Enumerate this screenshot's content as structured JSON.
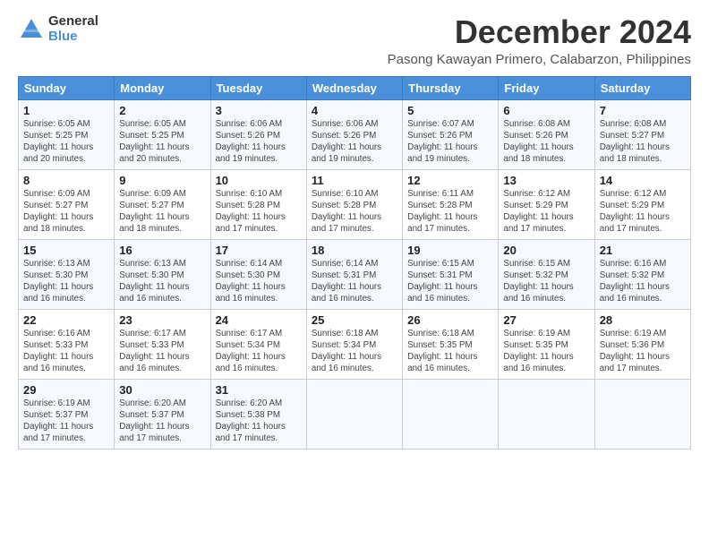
{
  "logo": {
    "line1": "General",
    "line2": "Blue"
  },
  "title": "December 2024",
  "subtitle": "Pasong Kawayan Primero, Calabarzon, Philippines",
  "weekdays": [
    "Sunday",
    "Monday",
    "Tuesday",
    "Wednesday",
    "Thursday",
    "Friday",
    "Saturday"
  ],
  "weeks": [
    [
      {
        "day": "1",
        "info": "Sunrise: 6:05 AM\nSunset: 5:25 PM\nDaylight: 11 hours\nand 20 minutes."
      },
      {
        "day": "2",
        "info": "Sunrise: 6:05 AM\nSunset: 5:25 PM\nDaylight: 11 hours\nand 20 minutes."
      },
      {
        "day": "3",
        "info": "Sunrise: 6:06 AM\nSunset: 5:26 PM\nDaylight: 11 hours\nand 19 minutes."
      },
      {
        "day": "4",
        "info": "Sunrise: 6:06 AM\nSunset: 5:26 PM\nDaylight: 11 hours\nand 19 minutes."
      },
      {
        "day": "5",
        "info": "Sunrise: 6:07 AM\nSunset: 5:26 PM\nDaylight: 11 hours\nand 19 minutes."
      },
      {
        "day": "6",
        "info": "Sunrise: 6:08 AM\nSunset: 5:26 PM\nDaylight: 11 hours\nand 18 minutes."
      },
      {
        "day": "7",
        "info": "Sunrise: 6:08 AM\nSunset: 5:27 PM\nDaylight: 11 hours\nand 18 minutes."
      }
    ],
    [
      {
        "day": "8",
        "info": "Sunrise: 6:09 AM\nSunset: 5:27 PM\nDaylight: 11 hours\nand 18 minutes."
      },
      {
        "day": "9",
        "info": "Sunrise: 6:09 AM\nSunset: 5:27 PM\nDaylight: 11 hours\nand 18 minutes."
      },
      {
        "day": "10",
        "info": "Sunrise: 6:10 AM\nSunset: 5:28 PM\nDaylight: 11 hours\nand 17 minutes."
      },
      {
        "day": "11",
        "info": "Sunrise: 6:10 AM\nSunset: 5:28 PM\nDaylight: 11 hours\nand 17 minutes."
      },
      {
        "day": "12",
        "info": "Sunrise: 6:11 AM\nSunset: 5:28 PM\nDaylight: 11 hours\nand 17 minutes."
      },
      {
        "day": "13",
        "info": "Sunrise: 6:12 AM\nSunset: 5:29 PM\nDaylight: 11 hours\nand 17 minutes."
      },
      {
        "day": "14",
        "info": "Sunrise: 6:12 AM\nSunset: 5:29 PM\nDaylight: 11 hours\nand 17 minutes."
      }
    ],
    [
      {
        "day": "15",
        "info": "Sunrise: 6:13 AM\nSunset: 5:30 PM\nDaylight: 11 hours\nand 16 minutes."
      },
      {
        "day": "16",
        "info": "Sunrise: 6:13 AM\nSunset: 5:30 PM\nDaylight: 11 hours\nand 16 minutes."
      },
      {
        "day": "17",
        "info": "Sunrise: 6:14 AM\nSunset: 5:30 PM\nDaylight: 11 hours\nand 16 minutes."
      },
      {
        "day": "18",
        "info": "Sunrise: 6:14 AM\nSunset: 5:31 PM\nDaylight: 11 hours\nand 16 minutes."
      },
      {
        "day": "19",
        "info": "Sunrise: 6:15 AM\nSunset: 5:31 PM\nDaylight: 11 hours\nand 16 minutes."
      },
      {
        "day": "20",
        "info": "Sunrise: 6:15 AM\nSunset: 5:32 PM\nDaylight: 11 hours\nand 16 minutes."
      },
      {
        "day": "21",
        "info": "Sunrise: 6:16 AM\nSunset: 5:32 PM\nDaylight: 11 hours\nand 16 minutes."
      }
    ],
    [
      {
        "day": "22",
        "info": "Sunrise: 6:16 AM\nSunset: 5:33 PM\nDaylight: 11 hours\nand 16 minutes."
      },
      {
        "day": "23",
        "info": "Sunrise: 6:17 AM\nSunset: 5:33 PM\nDaylight: 11 hours\nand 16 minutes."
      },
      {
        "day": "24",
        "info": "Sunrise: 6:17 AM\nSunset: 5:34 PM\nDaylight: 11 hours\nand 16 minutes."
      },
      {
        "day": "25",
        "info": "Sunrise: 6:18 AM\nSunset: 5:34 PM\nDaylight: 11 hours\nand 16 minutes."
      },
      {
        "day": "26",
        "info": "Sunrise: 6:18 AM\nSunset: 5:35 PM\nDaylight: 11 hours\nand 16 minutes."
      },
      {
        "day": "27",
        "info": "Sunrise: 6:19 AM\nSunset: 5:35 PM\nDaylight: 11 hours\nand 16 minutes."
      },
      {
        "day": "28",
        "info": "Sunrise: 6:19 AM\nSunset: 5:36 PM\nDaylight: 11 hours\nand 17 minutes."
      }
    ],
    [
      {
        "day": "29",
        "info": "Sunrise: 6:19 AM\nSunset: 5:37 PM\nDaylight: 11 hours\nand 17 minutes."
      },
      {
        "day": "30",
        "info": "Sunrise: 6:20 AM\nSunset: 5:37 PM\nDaylight: 11 hours\nand 17 minutes."
      },
      {
        "day": "31",
        "info": "Sunrise: 6:20 AM\nSunset: 5:38 PM\nDaylight: 11 hours\nand 17 minutes."
      },
      {
        "day": "",
        "info": ""
      },
      {
        "day": "",
        "info": ""
      },
      {
        "day": "",
        "info": ""
      },
      {
        "day": "",
        "info": ""
      }
    ]
  ]
}
